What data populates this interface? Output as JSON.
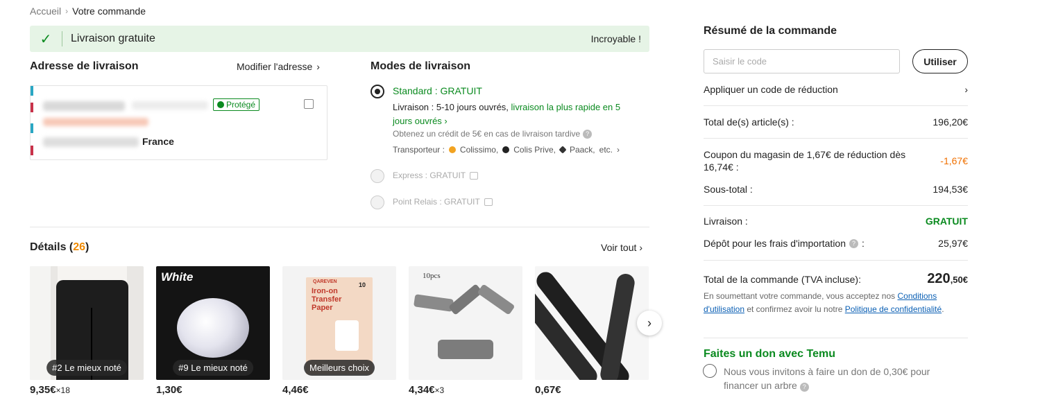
{
  "breadcrumb": {
    "home": "Accueil",
    "sep": "›",
    "current": "Votre commande"
  },
  "banner": {
    "title": "Livraison gratuite",
    "right": "Incroyable !",
    "color": "#0a8a1f"
  },
  "address": {
    "heading": "Adresse de livraison",
    "modify": "Modifier l'adresse",
    "protected_badge": "Protégé",
    "country": "France"
  },
  "delivery": {
    "heading": "Modes de livraison",
    "standard": {
      "title": "Standard : GRATUIT",
      "line1_prefix": "Livraison : 5-10 jours ouvrés,",
      "line1_green": "livraison la plus rapide en 5 jours ouvrés",
      "credit": "Obtenez un crédit de 5€ en cas de livraison tardive",
      "carriers_label": "Transporteur :",
      "carriers": [
        "Colissimo,",
        "Colis Prive,",
        "Paack,",
        "etc."
      ]
    },
    "express": "Express : GRATUIT",
    "relay": "Point Relais : GRATUIT"
  },
  "details": {
    "heading": "Détails",
    "count": "26",
    "see_all": "Voir tout",
    "products": [
      {
        "tag": "#2 Le mieux noté",
        "price": "9,35€",
        "qty": "×18"
      },
      {
        "tag": "#9 Le mieux noté",
        "price": "1,30€",
        "qty": "",
        "img_text": "White"
      },
      {
        "tag": "Meilleurs choix",
        "price": "4,46€",
        "qty": "",
        "brand": "QAREVEN",
        "img_text": "Iron-on Transfer Paper",
        "count": "10"
      },
      {
        "tag": "",
        "price": "4,34€",
        "qty": "×3",
        "img_text": "10pcs"
      },
      {
        "tag": "",
        "price": "0,67€",
        "qty": ""
      }
    ]
  },
  "summary": {
    "title": "Résumé de la commande",
    "code_placeholder": "Saisir le code",
    "use_button": "Utiliser",
    "apply_discount": "Appliquer un code de réduction",
    "items_label": "Total de(s) article(s) :",
    "items_value": "196,20€",
    "coupon_label": "Coupon du magasin de 1,67€ de réduction dès 16,74€ :",
    "coupon_value": "-1,67€",
    "subtotal_label": "Sous-total :",
    "subtotal_value": "194,53€",
    "shipping_label": "Livraison :",
    "shipping_value": "GRATUIT",
    "import_label": "Dépôt pour les frais d'importation",
    "import_colon": ":",
    "import_value": "25,97€",
    "total_label": "Total de la commande (TVA incluse):",
    "total_int": "220",
    "total_dec": ",50€",
    "legal_1": "En soumettant votre commande, vous acceptez nos",
    "legal_link1": "Conditions d'utilisation",
    "legal_2": "et confirmez avoir lu notre",
    "legal_link2": "Politique de confidentialité",
    "legal_3": ".",
    "donate_title": "Faites un don avec Temu",
    "donate_text": "Nous vous invitons à faire un don de 0,30€ pour financer un arbre"
  }
}
